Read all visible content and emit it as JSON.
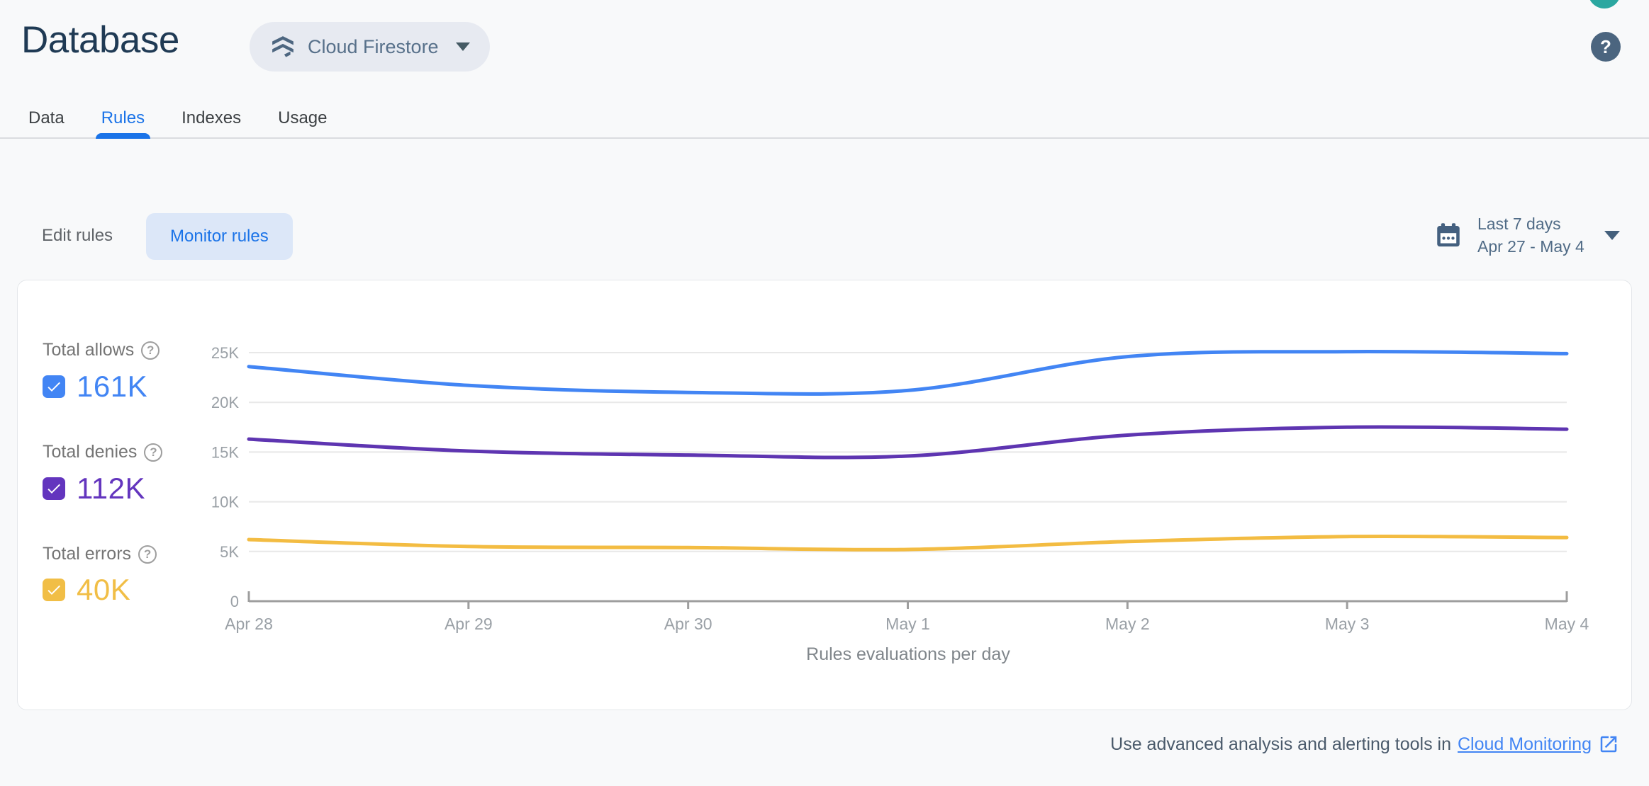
{
  "header": {
    "title": "Database",
    "product_selector": {
      "label": "Cloud Firestore"
    }
  },
  "icons": {
    "help_glyph": "?"
  },
  "tabs": [
    {
      "label": "Data",
      "active": false
    },
    {
      "label": "Rules",
      "active": true
    },
    {
      "label": "Indexes",
      "active": false
    },
    {
      "label": "Usage",
      "active": false
    }
  ],
  "toolbar": {
    "edit_rules_label": "Edit rules",
    "monitor_rules_label": "Monitor rules",
    "date_range": {
      "primary": "Last 7 days",
      "secondary": "Apr 27 - May 4"
    }
  },
  "legend": [
    {
      "label": "Total allows",
      "value": "161K",
      "color": "#4285F4"
    },
    {
      "label": "Total denies",
      "value": "112K",
      "color": "#6335BE"
    },
    {
      "label": "Total errors",
      "value": "40K",
      "color": "#F1BE46"
    }
  ],
  "chart_data": {
    "type": "line",
    "title": "Rules evaluations per day",
    "categories": [
      "Apr 28",
      "Apr 29",
      "Apr 30",
      "May 1",
      "May 2",
      "May 3",
      "May 4"
    ],
    "series": [
      {
        "name": "Total allows",
        "color": "#4285F4",
        "values": [
          23600,
          21700,
          21000,
          21200,
          24600,
          25100,
          24900
        ]
      },
      {
        "name": "Total denies",
        "color": "#5E35B1",
        "values": [
          16300,
          15100,
          14700,
          14600,
          16700,
          17500,
          17300
        ]
      },
      {
        "name": "Total errors",
        "color": "#F3BC42",
        "values": [
          6200,
          5500,
          5400,
          5200,
          6000,
          6500,
          6400
        ]
      }
    ],
    "ylim": [
      0,
      25000
    ],
    "yticks": [
      0,
      5000,
      10000,
      15000,
      20000,
      25000
    ],
    "ytick_labels": [
      "0",
      "5K",
      "10K",
      "15K",
      "20K",
      "25K"
    ],
    "grid": true,
    "legend_position": "left",
    "colors": {
      "gridline": "#E8E8E8",
      "axis": "#9E9E9E",
      "tick_label": "#9AA0A6"
    }
  },
  "footer": {
    "text": "Use advanced analysis and alerting tools in",
    "link_label": "Cloud Monitoring"
  }
}
